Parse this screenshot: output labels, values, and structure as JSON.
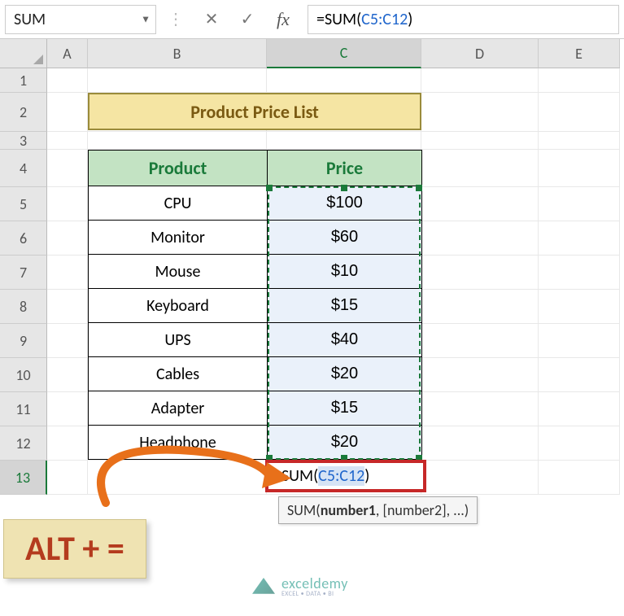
{
  "formula_bar": {
    "name_box": "SUM",
    "formula_prefix": "=SUM(",
    "formula_ref": "C5:C12",
    "formula_suffix": ")"
  },
  "columns": [
    "A",
    "B",
    "C",
    "D",
    "E"
  ],
  "rows": [
    "1",
    "2",
    "3",
    "4",
    "5",
    "6",
    "7",
    "8",
    "9",
    "10",
    "11",
    "12",
    "13"
  ],
  "selected_col": "C",
  "selected_row": "13",
  "title": "Product Price List",
  "headers": {
    "product": "Product",
    "price": "Price"
  },
  "products": [
    {
      "name": "CPU",
      "price": "$100"
    },
    {
      "name": "Monitor",
      "price": "$60"
    },
    {
      "name": "Mouse",
      "price": "$10"
    },
    {
      "name": "Keyboard",
      "price": "$15"
    },
    {
      "name": "UPS",
      "price": "$40"
    },
    {
      "name": "Cables",
      "price": "$20"
    },
    {
      "name": "Adapter",
      "price": "$15"
    },
    {
      "name": "Headphone",
      "price": "$20"
    }
  ],
  "active_cell": {
    "prefix": "=SUM(",
    "ref": "C5:C12",
    "suffix": ")"
  },
  "tooltip": {
    "fn": "SUM",
    "arg1": "number1",
    "rest": ", [number2], ...)"
  },
  "callout": "ALT + =",
  "watermark": {
    "name": "exceldemy",
    "sub": "EXCEL • DATA • BI"
  },
  "row_heights": {
    "default": 42,
    "header": 36,
    "r2": 48,
    "r3": 20,
    "r4": 46
  },
  "col_widths": {
    "A": 50,
    "B": 220,
    "C": 190,
    "D": 144,
    "E": 100
  }
}
